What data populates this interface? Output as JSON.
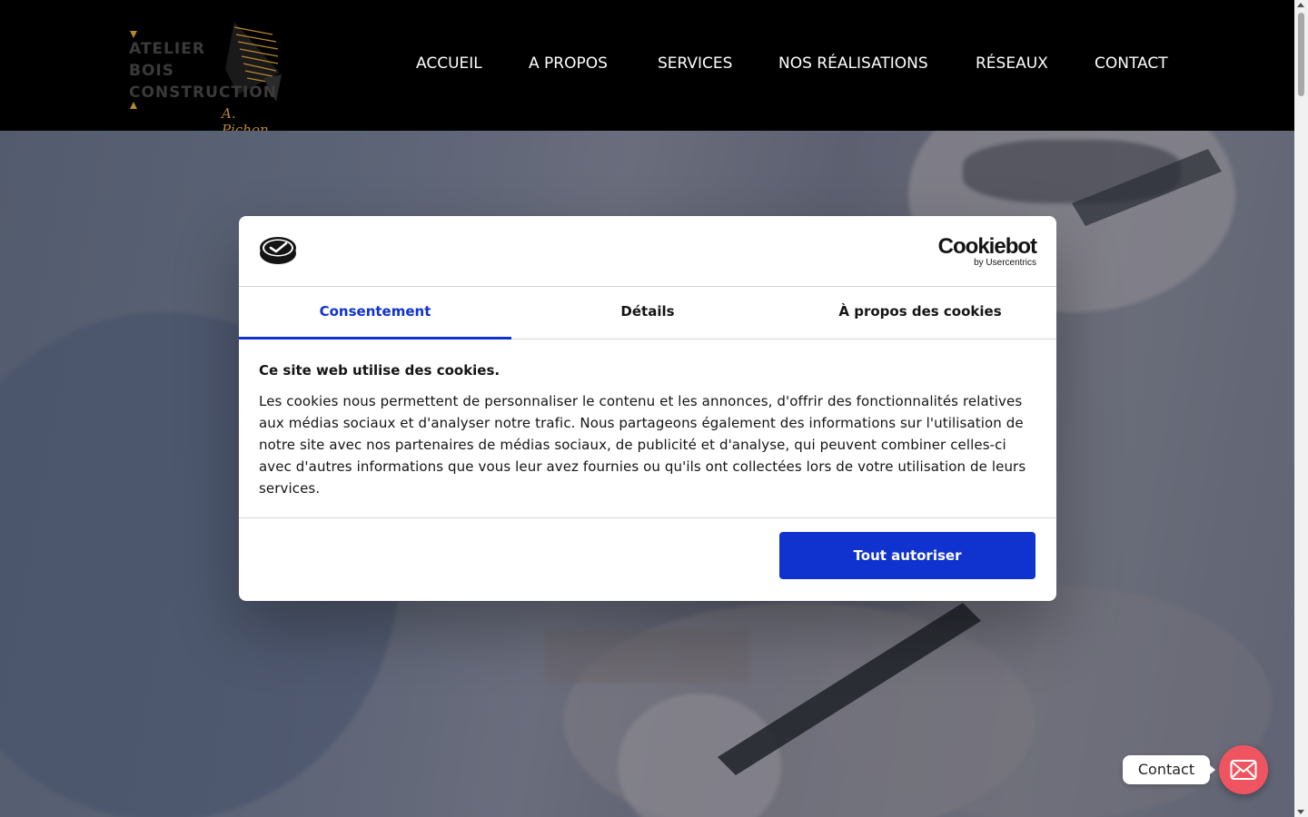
{
  "header": {
    "logo": {
      "line1": "ATELIER",
      "line2": "BOIS",
      "line3": "CONSTRUCTION",
      "signature": "A. Pichon"
    },
    "nav": [
      {
        "label": "ACCUEIL"
      },
      {
        "label": "A PROPOS"
      },
      {
        "label": "SERVICES"
      },
      {
        "label": "NOS RÉALISATIONS"
      },
      {
        "label": "RÉSEAUX"
      },
      {
        "label": "CONTACT"
      }
    ]
  },
  "cookie_dialog": {
    "brand_name": "Cookiebot",
    "brand_sub": "by Usercentrics",
    "tabs": [
      {
        "label": "Consentement",
        "active": true
      },
      {
        "label": "Détails",
        "active": false
      },
      {
        "label": "À propos des cookies",
        "active": false
      }
    ],
    "heading": "Ce site web utilise des cookies.",
    "body": "Les cookies nous permettent de personnaliser le contenu et les annonces, d'offrir des fonctionnalités relatives aux médias sociaux et d'analyser notre trafic. Nous partageons également des informations sur l'utilisation de notre site avec nos partenaires de médias sociaux, de publicité et d'analyse, qui peuvent combiner celles-ci avec d'autres informations que vous leur avez fournies ou qu'ils ont collectées lors de votre utilisation de leurs services.",
    "allow_button": "Tout autoriser"
  },
  "floating_contact": {
    "label": "Contact",
    "icon": "envelope-icon"
  },
  "colors": {
    "header_bg": "#000000",
    "accent_blue": "#1032cf",
    "fab_red": "#ef5560",
    "logo_gold": "#b8862e"
  }
}
